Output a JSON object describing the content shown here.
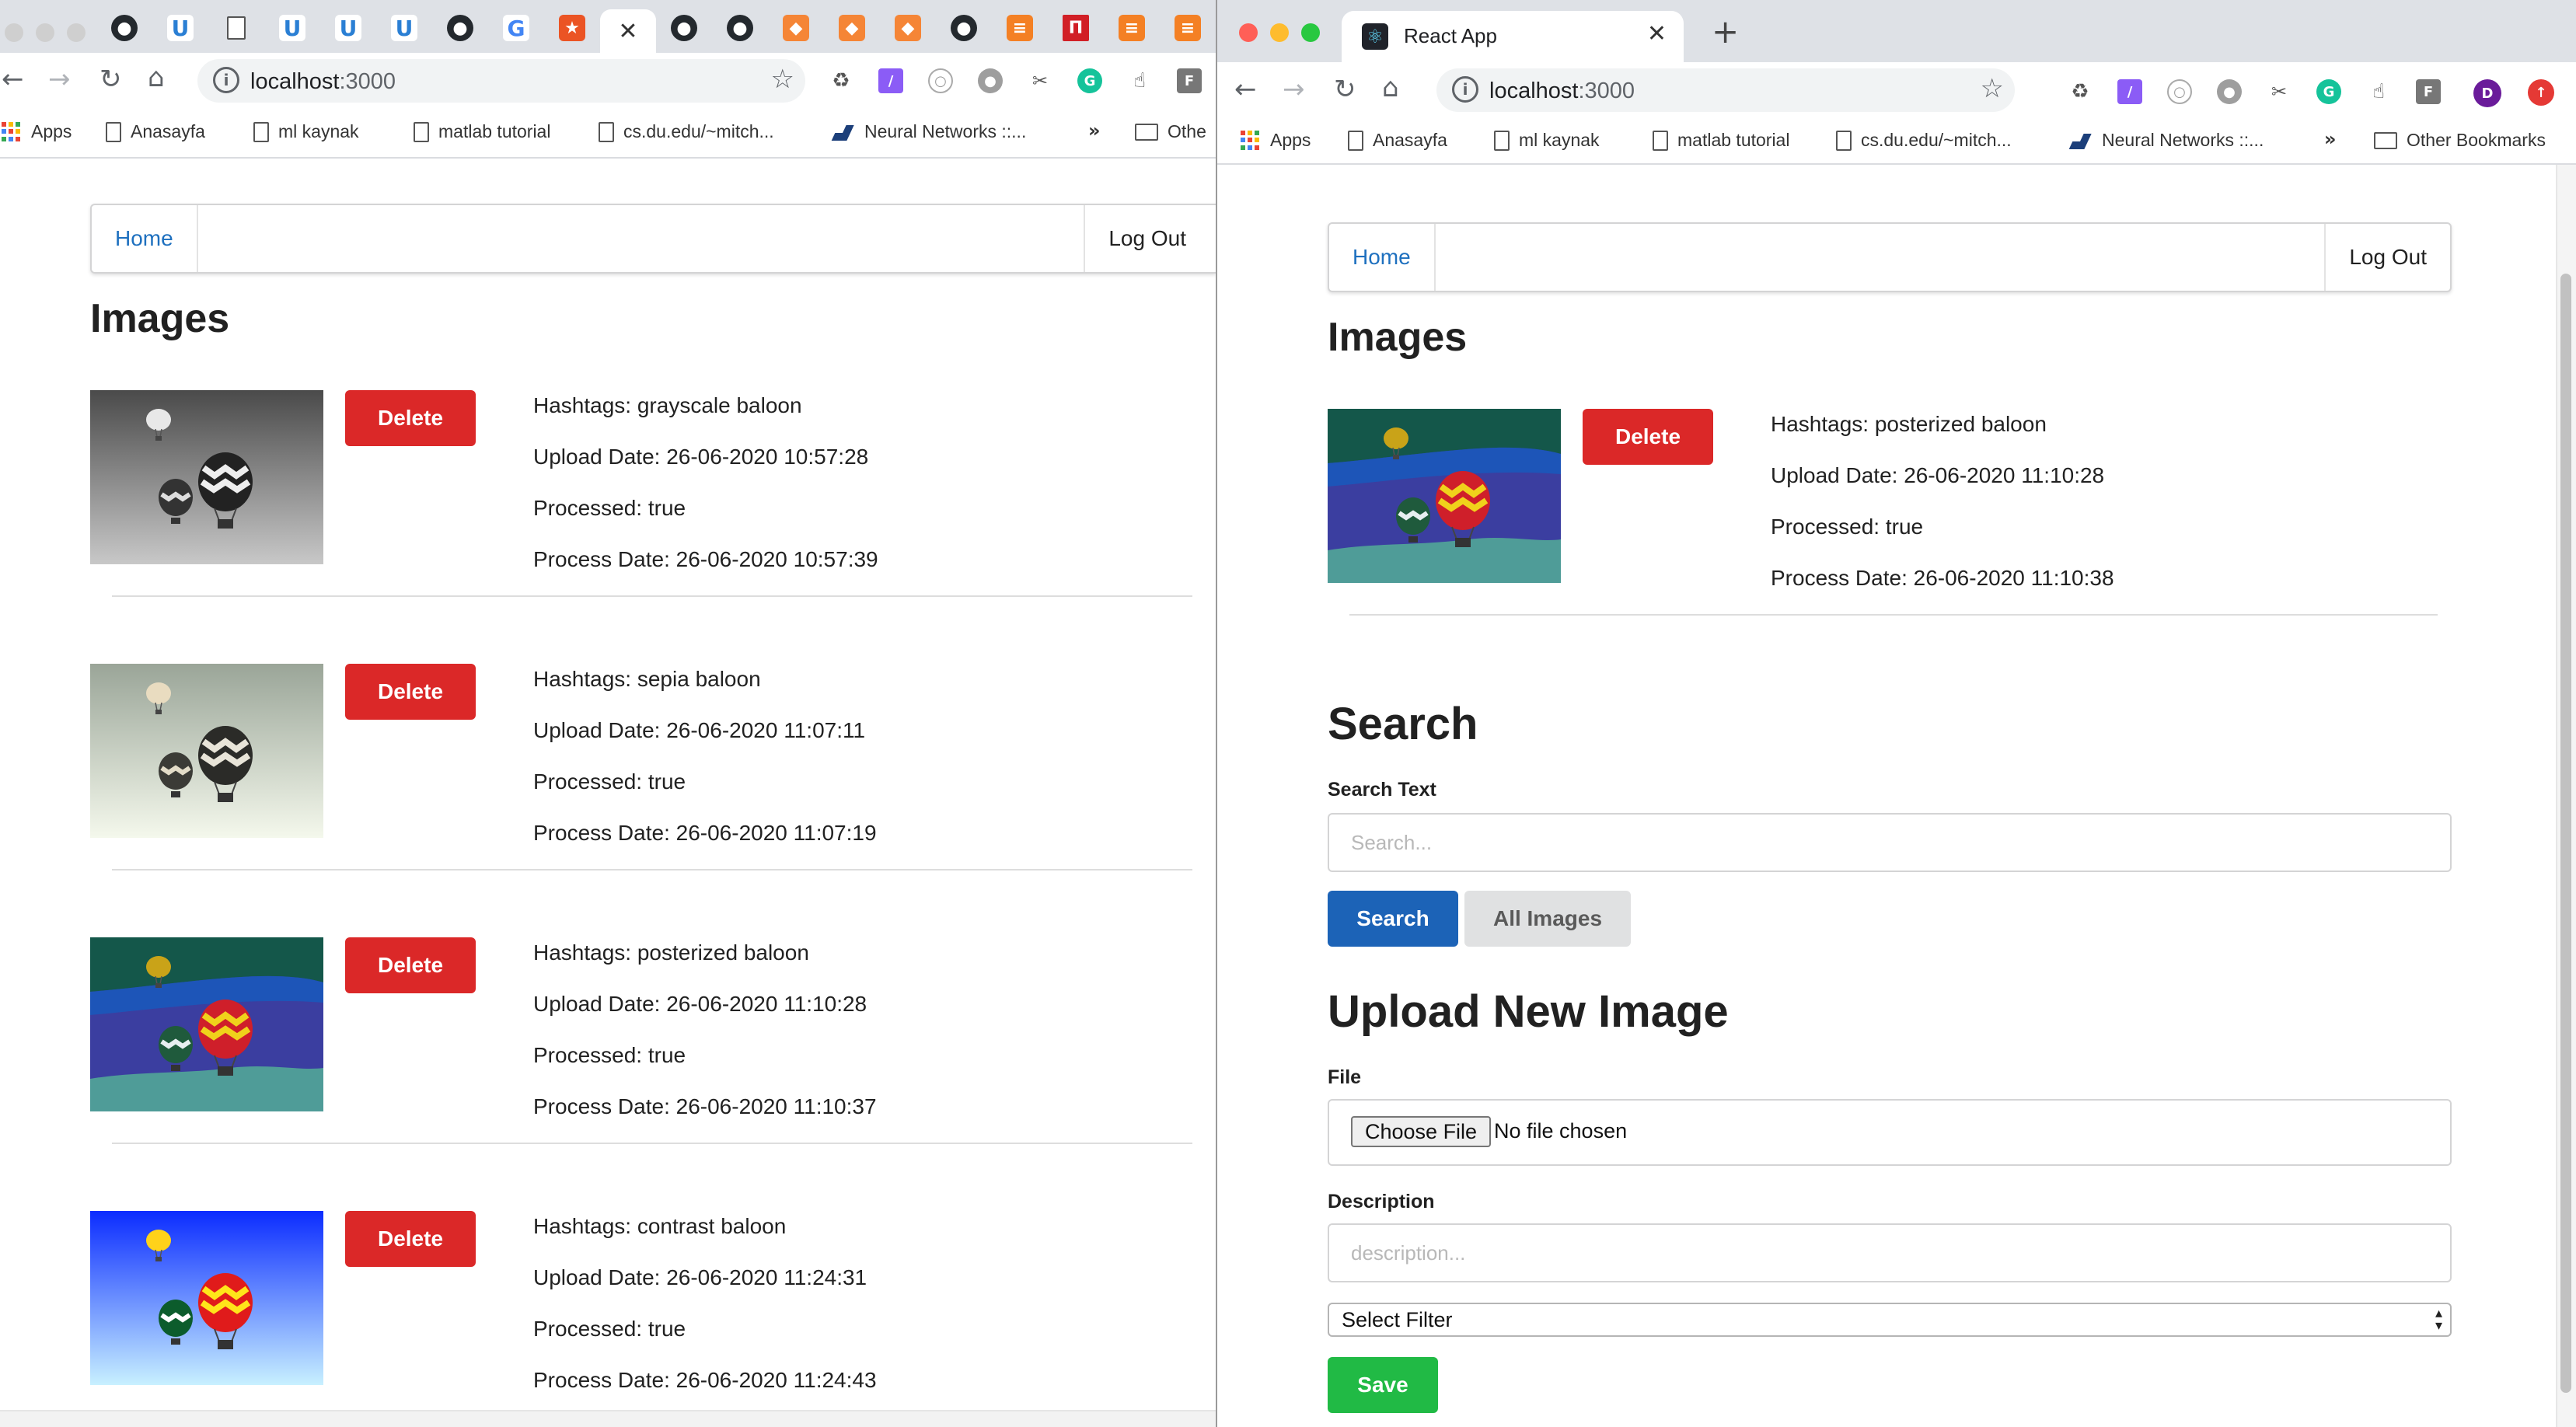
{
  "left_window": {
    "url_host": "localhost",
    "url_port": ":3000",
    "bookmarks": [
      "Apps",
      "Anasayfa",
      "ml kaynak",
      "matlab tutorial",
      "cs.du.edu/~mitch...",
      "Neural Networks ::...",
      "»",
      "Othe"
    ],
    "page": {
      "nav_home": "Home",
      "nav_logout": "Log Out",
      "heading": "Images",
      "delete_label": "Delete",
      "items": [
        {
          "filter": "grayscale",
          "hashtags": "Hashtags: grayscale baloon",
          "upload": "Upload Date: 26-06-2020 10:57:28",
          "processed": "Processed: true",
          "process_date": "Process Date: 26-06-2020 10:57:39"
        },
        {
          "filter": "sepia",
          "hashtags": "Hashtags: sepia baloon",
          "upload": "Upload Date: 26-06-2020 11:07:11",
          "processed": "Processed: true",
          "process_date": "Process Date: 26-06-2020 11:07:19"
        },
        {
          "filter": "posterized",
          "hashtags": "Hashtags: posterized baloon",
          "upload": "Upload Date: 26-06-2020 11:10:28",
          "processed": "Processed: true",
          "process_date": "Process Date: 26-06-2020 11:10:37"
        },
        {
          "filter": "contrast",
          "hashtags": "Hashtags: contrast baloon",
          "upload": "Upload Date: 26-06-2020 11:24:31",
          "processed": "Processed: true",
          "process_date": "Process Date: 26-06-2020 11:24:43"
        }
      ]
    }
  },
  "right_window": {
    "tab_title": "React App",
    "url_host": "localhost",
    "url_port": ":3000",
    "bookmarks": [
      "Apps",
      "Anasayfa",
      "ml kaynak",
      "matlab tutorial",
      "cs.du.edu/~mitch...",
      "Neural Networks ::...",
      "»",
      "Other Bookmarks"
    ],
    "profile_initial": "D",
    "page": {
      "nav_home": "Home",
      "nav_logout": "Log Out",
      "heading": "Images",
      "delete_label": "Delete",
      "items": [
        {
          "filter": "posterized",
          "hashtags": "Hashtags: posterized baloon",
          "upload": "Upload Date: 26-06-2020 11:10:28",
          "processed": "Processed: true",
          "process_date": "Process Date: 26-06-2020 11:10:38"
        }
      ],
      "search": {
        "heading": "Search",
        "label": "Search Text",
        "placeholder": "Search...",
        "value": "",
        "search_button": "Search",
        "all_button": "All Images"
      },
      "upload": {
        "heading": "Upload New Image",
        "file_label": "File",
        "choose_file": "Choose File",
        "no_file": "No file chosen",
        "description_label": "Description",
        "description_placeholder": "description...",
        "description_value": "",
        "filter_selected": "Select Filter",
        "save_button": "Save"
      }
    }
  },
  "colors": {
    "delete_red": "#db2828",
    "search_blue": "#1c63b7",
    "save_green": "#21ba45",
    "link_blue": "#1e70bf"
  }
}
